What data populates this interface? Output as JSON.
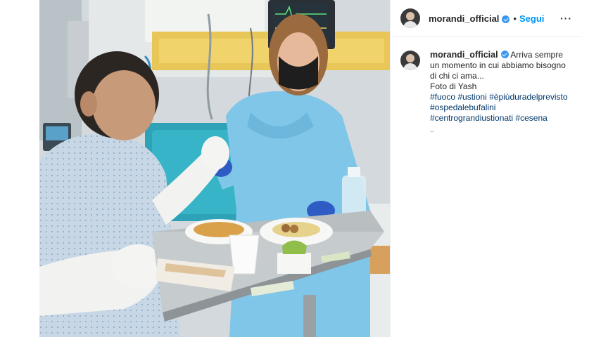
{
  "post": {
    "username": "morandi_official",
    "follow_label": "Segui",
    "separator": "•",
    "more_label": "···",
    "caption": {
      "line1": "Arriva sempre un momento in cui abbiamo bisogno di chi ci ama...",
      "line2": "Foto di Yash",
      "hashtags": [
        "#fuoco",
        "#ustioni",
        "#èpiùduradelprevisto",
        "#ospedalebufalini",
        "#centrograndiustionati",
        "#cesena"
      ]
    },
    "icons": {
      "verified": "verified-badge-icon",
      "more": "more-options-icon"
    },
    "colors": {
      "link": "#0095f6",
      "hashtag": "#00376b",
      "verified": "#3897f0",
      "text": "#262626"
    }
  }
}
